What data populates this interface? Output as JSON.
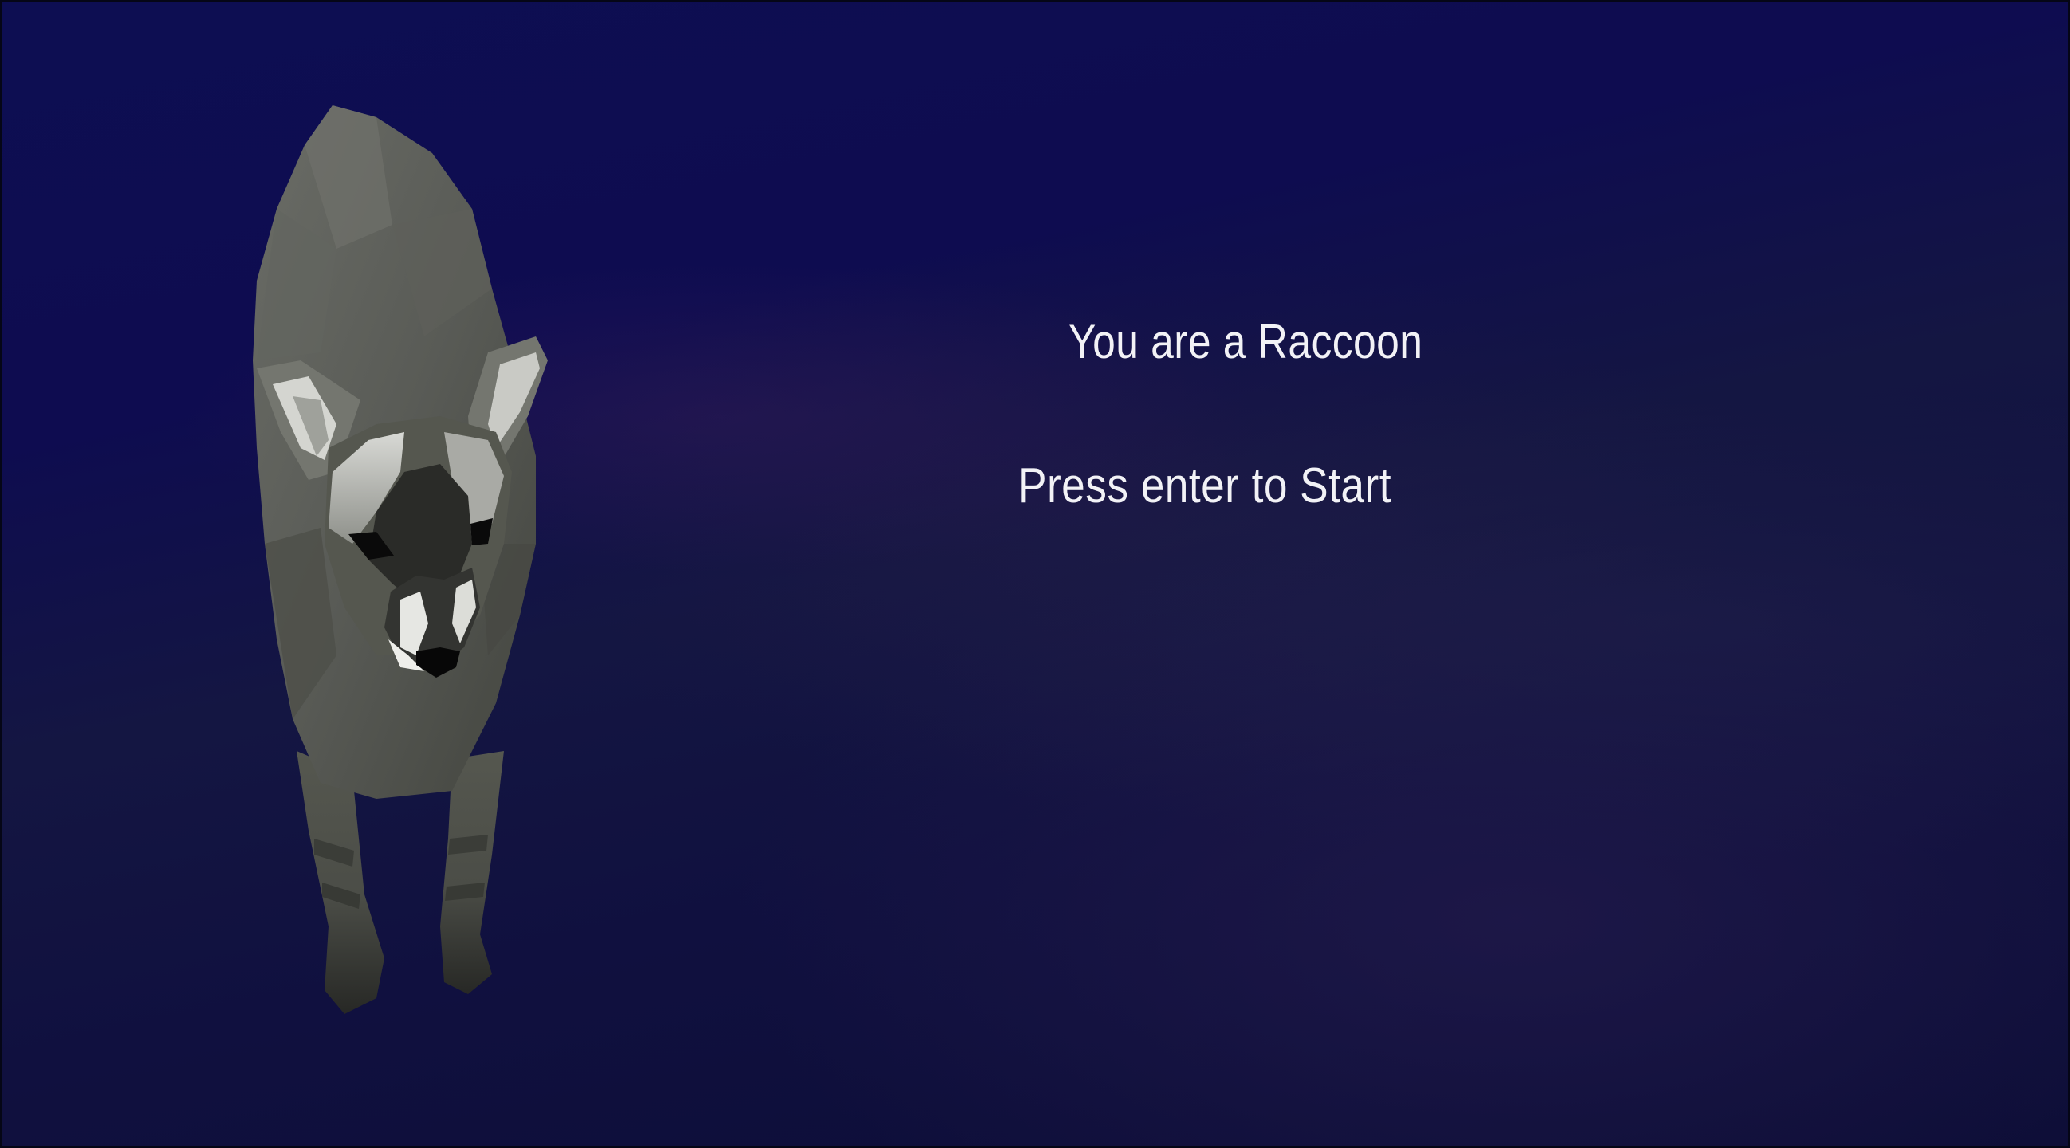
{
  "scene": {
    "title": "You are a Raccoon",
    "prompt": "Press enter to Start",
    "character_icon": "raccoon-model",
    "colors": {
      "background_top": "#0d0e52",
      "background_bottom": "#0c0d36",
      "text": "#f2f2f6",
      "fur": "#5a5c57"
    }
  }
}
